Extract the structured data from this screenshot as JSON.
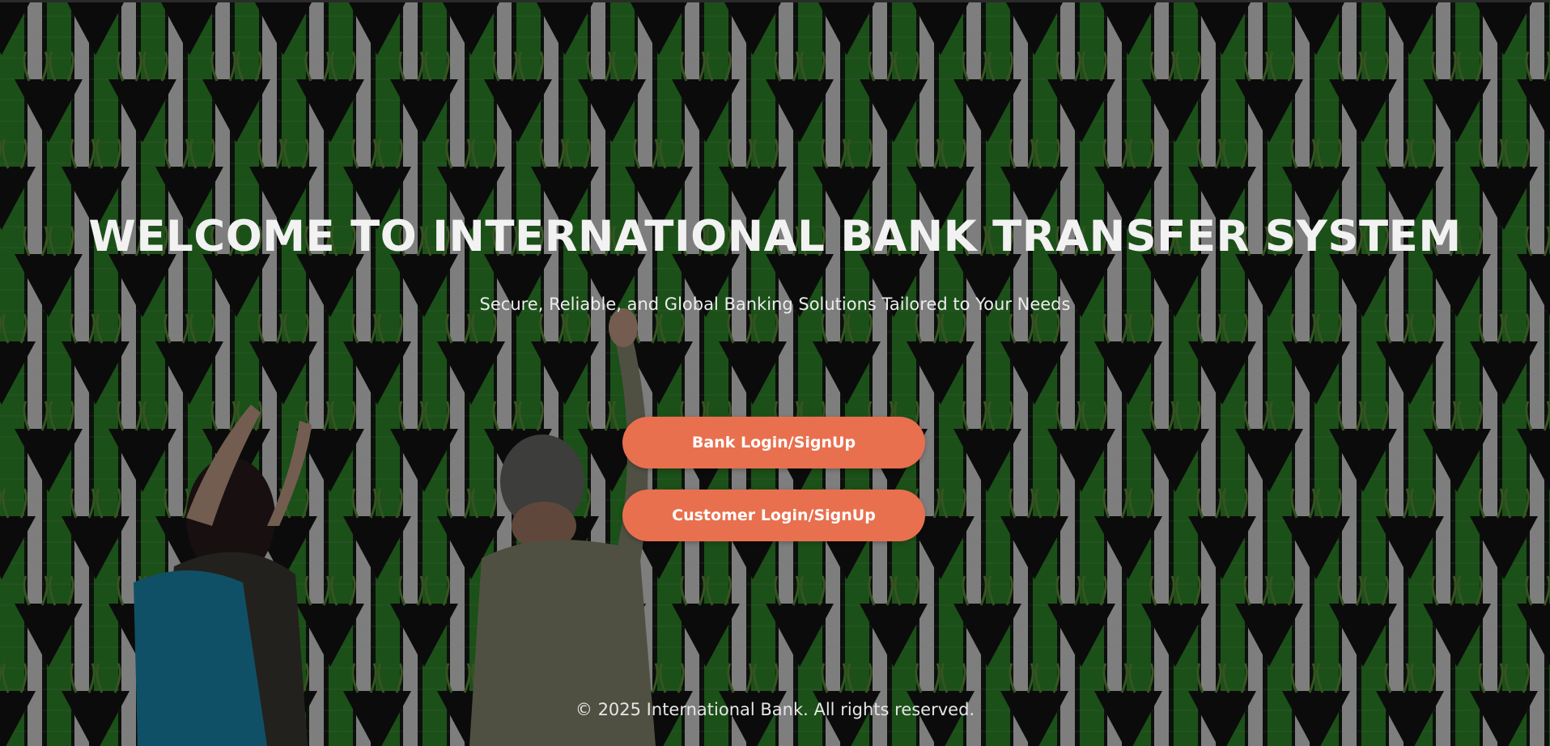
{
  "hero": {
    "title": "WELCOME TO INTERNATIONAL BANK TRANSFER SYSTEM",
    "subtitle": "Secure, Reliable, and Global Banking Solutions Tailored to Your Needs"
  },
  "actions": {
    "bank_login_label": "Bank Login/SignUp",
    "customer_login_label": "Customer Login/SignUp"
  },
  "footer": {
    "copyright": "© 2025 International Bank. All rights reserved."
  },
  "colors": {
    "button_bg": "#e8704f",
    "button_text": "#ffffff",
    "text": "#f2f2f2",
    "wall_green": "#2f8a2a",
    "wall_white": "#d9d9d9",
    "planter": "#141414"
  }
}
